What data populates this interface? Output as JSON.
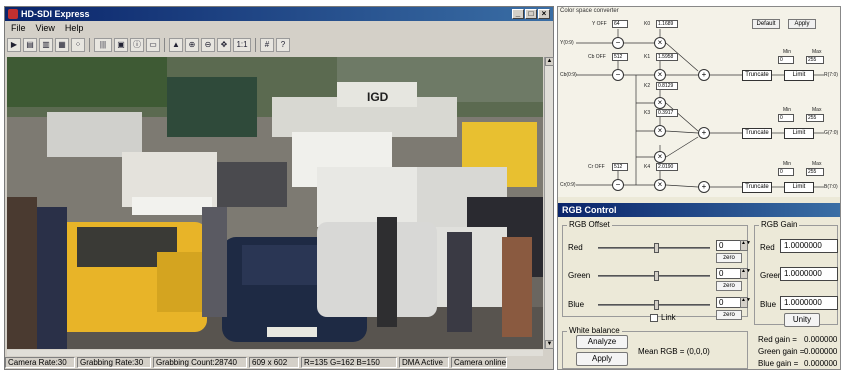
{
  "window": {
    "title": "HD-SDI Express",
    "min": "_",
    "max": "□",
    "close": "×"
  },
  "menu": [
    "File",
    "View",
    "Help"
  ],
  "toolbar": {
    "icons": [
      "capture-icon",
      "save-icon",
      "open-icon",
      "copy-icon",
      "grid-icon",
      "bars-icon",
      "export-icon",
      "info-icon",
      "display-icon",
      "histogram-icon",
      "zoom-in-icon",
      "zoom-out-icon",
      "fit-icon",
      "actual-size-icon",
      "crosshair-icon",
      "help-icon"
    ],
    "glyphs": [
      "▶",
      "▤",
      "▥",
      "▦",
      "⁘",
      "|||",
      "▣",
      "ⓘ",
      "▭",
      "▲",
      "⊕",
      "⊖",
      "✥",
      "1:1",
      "#",
      "?"
    ]
  },
  "status": {
    "camera_rate": "Camera Rate:30",
    "grabbing_rate": "Grabbing Rate:30",
    "grabbing_count": "Grabbing Count:28740",
    "size": "609 x 602",
    "rgb": "R=135 G=162 B=150",
    "dma": "DMA Active",
    "camera": "Camera online"
  },
  "csc": {
    "title": "Color space converter",
    "default": "Default",
    "apply": "Apply",
    "inputs": {
      "y": "Y(0:9)",
      "cb": "Cb(0:9)",
      "cr": "Cr(0:9)"
    },
    "offsets": {
      "y_off": "Y OFF",
      "y_off_val": "64",
      "cb_off": "Cb OFF",
      "cb_off_val": "512",
      "cr_off": "Cr OFF",
      "cr_off_val": "512"
    },
    "k": {
      "k0": "K0",
      "k0_val": "1.1689",
      "k1": "K1",
      "k1_val": "1.5958",
      "k2": "K2",
      "k2_val": "0.8129",
      "k3": "K3",
      "k3_val": "0.3917",
      "k4": "K4",
      "k4_val": "2.0190"
    },
    "rows": [
      {
        "trunc": "Truncate",
        "limit": "Limit",
        "out": "R(7:0)",
        "min_label": "Min",
        "min": "0",
        "max_label": "Max",
        "max": "255"
      },
      {
        "trunc": "Truncate",
        "limit": "Limit",
        "out": "G(7:0)",
        "min_label": "Min",
        "min": "0",
        "max_label": "Max",
        "max": "255"
      },
      {
        "trunc": "Truncate",
        "limit": "Limit",
        "out": "B(7:0)",
        "min_label": "Min",
        "min": "0",
        "max_label": "Max",
        "max": "255"
      }
    ],
    "ops": {
      "minus": "−",
      "mult": "×",
      "plus": "+"
    }
  },
  "rgb": {
    "title": "RGB Control",
    "offset": {
      "label": "RGB Offset",
      "red": "Red",
      "green": "Green",
      "blue": "Blue",
      "red_val": "0",
      "green_val": "0",
      "blue_val": "0",
      "zero": "zero",
      "link": "Link"
    },
    "gain": {
      "label": "RGB Gain",
      "red": "Red",
      "green": "Green",
      "blue": "Blue",
      "red_val": "1.0000000",
      "green_val": "1.0000000",
      "blue_val": "1.0000000",
      "unity": "Unity"
    },
    "wb": {
      "label": "White balance",
      "analyze": "Analyze",
      "apply": "Apply",
      "mean": "Mean RGB = (0,0,0)",
      "red_gain": "Red gain =",
      "red_gain_val": "0.000000",
      "green_gain": "Green gain =",
      "green_gain_val": "0.000000",
      "blue_gain": "Blue gain =",
      "blue_gain_val": "0.000000"
    }
  }
}
